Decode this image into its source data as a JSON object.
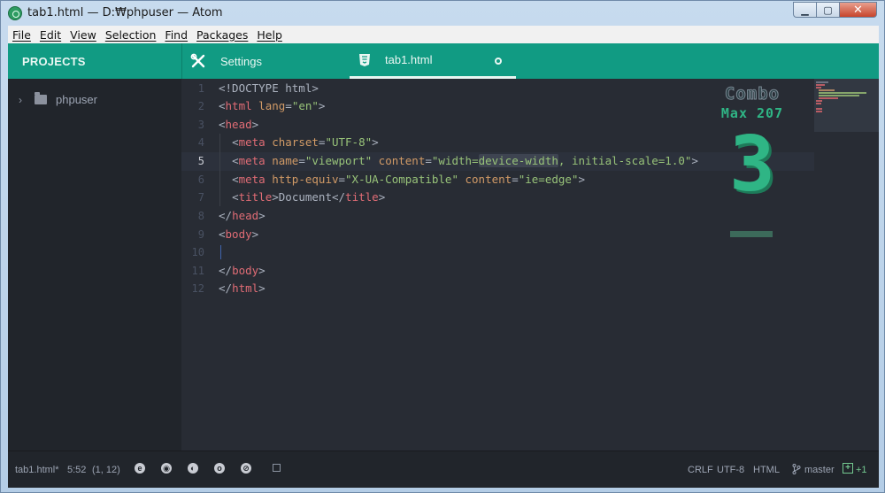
{
  "window": {
    "title": "tab1.html — D:₩phpuser — Atom",
    "minimize_icon": "minimize-icon",
    "maximize_icon": "maximize-icon",
    "close_icon": "close-icon"
  },
  "menu": [
    "File",
    "Edit",
    "View",
    "Selection",
    "Find",
    "Packages",
    "Help"
  ],
  "tree": {
    "header": "PROJECTS",
    "root": "phpuser"
  },
  "tabs": [
    {
      "label": "Settings",
      "icon": "tools-icon"
    },
    {
      "label": "tab1.html",
      "icon": "html5-icon",
      "modified": true
    }
  ],
  "editor": {
    "line_numbers": [
      "1",
      "2",
      "3",
      "4",
      "5",
      "6",
      "7",
      "8",
      "9",
      "10",
      "11",
      "12"
    ],
    "active_line": 5
  },
  "combo": {
    "label": "Combo",
    "max": "Max 207",
    "count": "3"
  },
  "status": {
    "file": "tab1.html*",
    "time": "5:52",
    "cursor": "(1, 12)",
    "line_ending": "CRLF",
    "encoding": "UTF-8",
    "grammar": "HTML",
    "branch": "master",
    "git_added": "+1"
  },
  "colors": {
    "accent": "#119b83",
    "tag": "#e06c75",
    "attr": "#d19a66",
    "string": "#98c379",
    "combo": "#2fb585"
  }
}
